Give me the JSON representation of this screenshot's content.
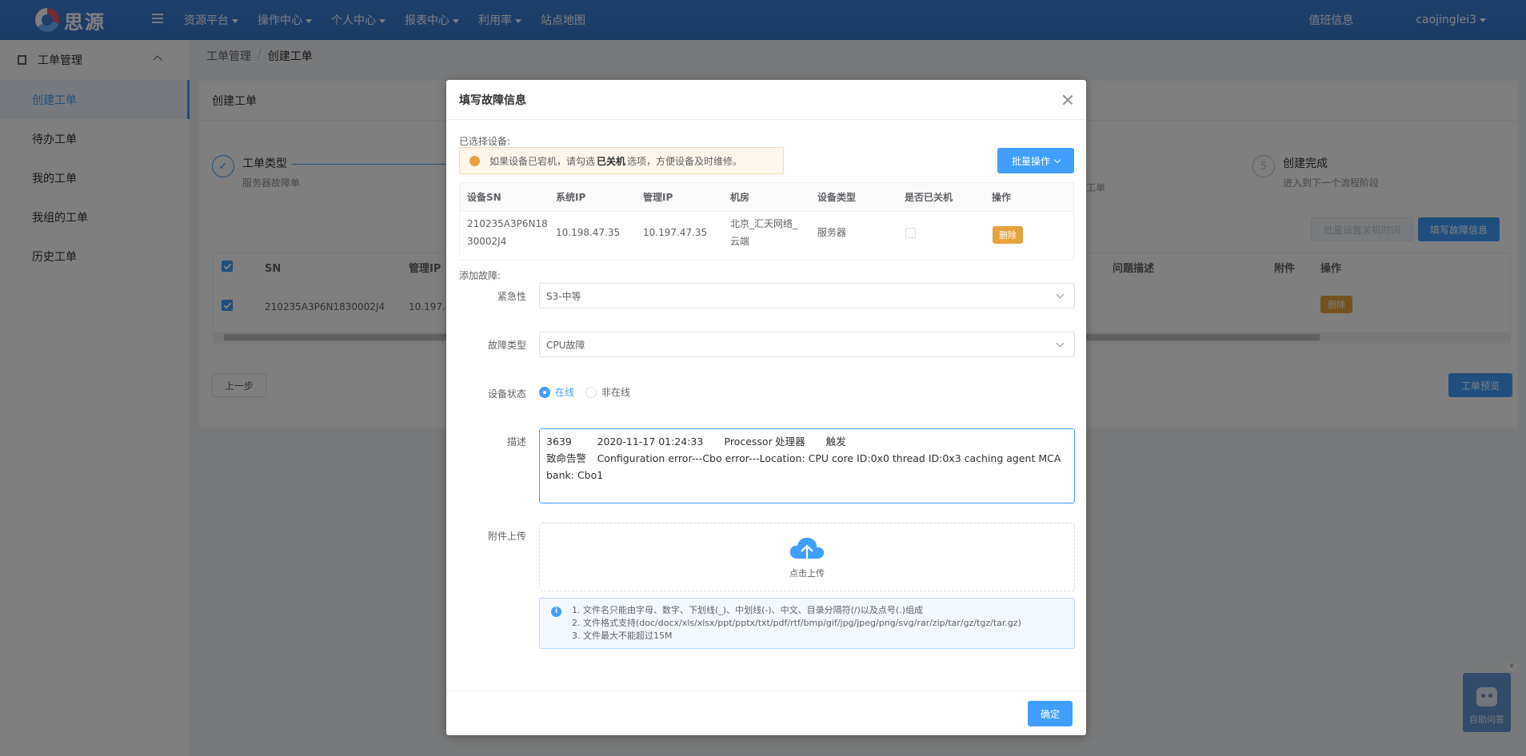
{
  "topbar": {
    "logo_text": "思源",
    "menu": [
      "资源平台",
      "操作中心",
      "个人中心",
      "报表中心",
      "利用率",
      "站点地图"
    ],
    "menu_has_caret": [
      true,
      true,
      true,
      true,
      true,
      false
    ],
    "duty_info": "值班信息",
    "username": "caojinglei3"
  },
  "sidebar": {
    "group_title": "工单管理",
    "items": [
      "创建工单",
      "待办工单",
      "我的工单",
      "我组的工单",
      "历史工单"
    ],
    "active_index": 0
  },
  "breadcrumb": {
    "root": "工单管理",
    "sep": "/",
    "current": "创建工单"
  },
  "card": {
    "title": "创建工单",
    "steps": [
      {
        "num": "✓",
        "title": "工单类型",
        "sub": "服务器故障单"
      },
      {
        "num": "5",
        "title": "创建完成",
        "sub": "进入到下一个流程阶段"
      }
    ],
    "step_partial_sub": "工单",
    "buttons": {
      "batch_shutdown": "批量设置关机时间",
      "fill_fault": "填写故障信息",
      "prev": "上一步",
      "preview": "工单预览"
    },
    "table": {
      "headers": [
        "SN",
        "管理IP",
        "问题描述",
        "附件",
        "操作"
      ],
      "row": {
        "sn": "210235A3P6N1830002J4",
        "ip_partial": "10.197.4",
        "action": "删除"
      }
    }
  },
  "dialog": {
    "title": "填写故障信息",
    "selected_label": "已选择设备:",
    "alert": {
      "prefix": "如果设备已宕机，请勾选",
      "highlight": "已关机",
      "suffix": "选项，方便设备及时维修。"
    },
    "bulk_button": "批量操作",
    "device_table": {
      "headers": [
        "设备SN",
        "系统IP",
        "管理IP",
        "机房",
        "设备类型",
        "是否已关机",
        "操作"
      ],
      "row": {
        "sn_line1": "210235A3P6N18",
        "sn_line2": "30002J4",
        "system_ip": "10.198.47.35",
        "manage_ip": "10.197.47.35",
        "room_line1": "北京_汇天网络_",
        "room_line2": "云端",
        "type": "服务器",
        "shutdown": false,
        "action": "删除"
      }
    },
    "add_fault_label": "添加故障:",
    "form": {
      "urgency_label": "紧急性",
      "urgency_value": "S3-中等",
      "fault_type_label": "故障类型",
      "fault_type_value": "CPU故障",
      "status_label": "设备状态",
      "status_options": [
        "在线",
        "非在线"
      ],
      "status_selected": 0,
      "desc_label": "描述",
      "desc_value": "3639\t2020-11-17 01:24:33\tProcessor\t处理器\t触发\n致命告警\tConfiguration error---Cbo error---Location: CPU core ID:0x0 thread ID:0x3 caching agent MCA bank: Cbo1",
      "upload_label": "附件上传",
      "upload_text": "点击上传",
      "notes": [
        "1. 文件名只能由字母、数字、下划线(_)、中划线(-)、中文、目录分隔符(/)以及点号(.)组成",
        "2. 文件格式支持(doc/docx/xls/xlsx/ppt/pptx/txt/pdf/rtf/bmp/gif/jpg/jpeg/png/svg/rar/zip/tar/gz/tgz/tar.gz)",
        "3. 文件最大不能超过15M"
      ]
    },
    "confirm_button": "确定"
  },
  "help_widget": {
    "label": "自助问答",
    "close": "×"
  },
  "colors": {
    "primary": "#409eff",
    "topbar": "#3a7bd5",
    "warning": "#e6a23c"
  }
}
